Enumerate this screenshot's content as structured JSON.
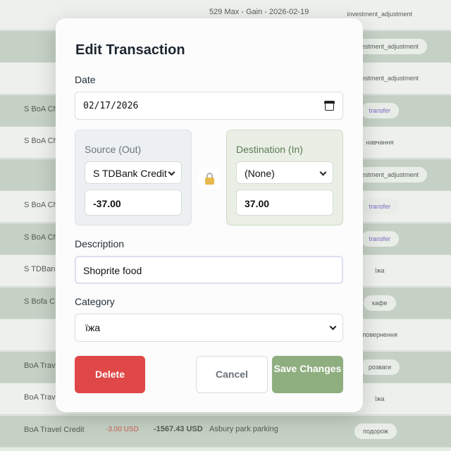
{
  "background_rows": [
    {
      "account": "",
      "amount_usd": "",
      "amount_total": "",
      "description": "529 Max - Gain - 2026-02-19",
      "category": "investment_adjustment",
      "tag_style": "plain",
      "shade": "light"
    },
    {
      "account": "",
      "amount_usd": "",
      "amount_total": "",
      "description": "",
      "category": "investment_adjustment",
      "tag_style": "pill",
      "shade": "dark"
    },
    {
      "account": "",
      "amount_usd": "",
      "amount_total": "",
      "description": "",
      "category": "investment_adjustment",
      "tag_style": "plain",
      "shade": "light"
    },
    {
      "account": "S BoA Checking",
      "amount_usd": "",
      "amount_total": "",
      "description": "",
      "category": "transfer",
      "tag_style": "transfer",
      "shade": "dark"
    },
    {
      "account": "S BoA Checking",
      "amount_usd": "",
      "amount_total": "",
      "description": "",
      "category": "навчання",
      "tag_style": "plain",
      "shade": "light"
    },
    {
      "account": "",
      "amount_usd": "",
      "amount_total": "",
      "description": "",
      "category": "investment_adjustment",
      "tag_style": "pill",
      "shade": "dark"
    },
    {
      "account": "S BoA Checking",
      "amount_usd": "",
      "amount_total": "",
      "description": "",
      "category": "transfer",
      "tag_style": "transfer",
      "shade": "light"
    },
    {
      "account": "S BoA Checking",
      "amount_usd": "",
      "amount_total": "",
      "description": "",
      "category": "transfer",
      "tag_style": "transfer",
      "shade": "dark"
    },
    {
      "account": "S TDBank",
      "amount_usd": "",
      "amount_total": "",
      "description": "",
      "category": "їжа",
      "tag_style": "plain",
      "shade": "light"
    },
    {
      "account": "S Bofa C",
      "amount_usd": "",
      "amount_total": "",
      "description": "",
      "category": "кафе",
      "tag_style": "pill",
      "shade": "dark"
    },
    {
      "account": "",
      "amount_usd": "",
      "amount_total": "",
      "description": "",
      "category": "повернення",
      "tag_style": "plain",
      "shade": "light"
    },
    {
      "account": "BoA Travel Credit",
      "amount_usd": "",
      "amount_total": "",
      "description": "",
      "category": "розваги",
      "tag_style": "pill",
      "shade": "dark"
    },
    {
      "account": "BoA Travel Credit",
      "amount_usd": "",
      "amount_total": "",
      "description": "",
      "category": "їжа",
      "tag_style": "plain",
      "shade": "light"
    },
    {
      "account": "BoA Travel Credit",
      "amount_usd": "-3.00 USD",
      "amount_total": "-1567.43 USD",
      "description": "Asbury park parking",
      "category": "подорож",
      "tag_style": "pill",
      "shade": "dark"
    }
  ],
  "modal": {
    "title": "Edit Transaction",
    "date_label": "Date",
    "date_value": "02/17/2026",
    "source": {
      "label": "Source (Out)",
      "account": "S TDBank Credit",
      "amount": "-37.00"
    },
    "destination": {
      "label": "Destination (In)",
      "account": "(None)",
      "amount": "37.00"
    },
    "description_label": "Description",
    "description_value": "Shoprite food",
    "category_label": "Category",
    "category_value": "їжа",
    "buttons": {
      "delete": "Delete",
      "cancel": "Cancel",
      "save": "Save Changes"
    }
  },
  "colors": {
    "delete": "#e04747",
    "save": "#8fae80",
    "accent_lock": "#e6b94a"
  }
}
